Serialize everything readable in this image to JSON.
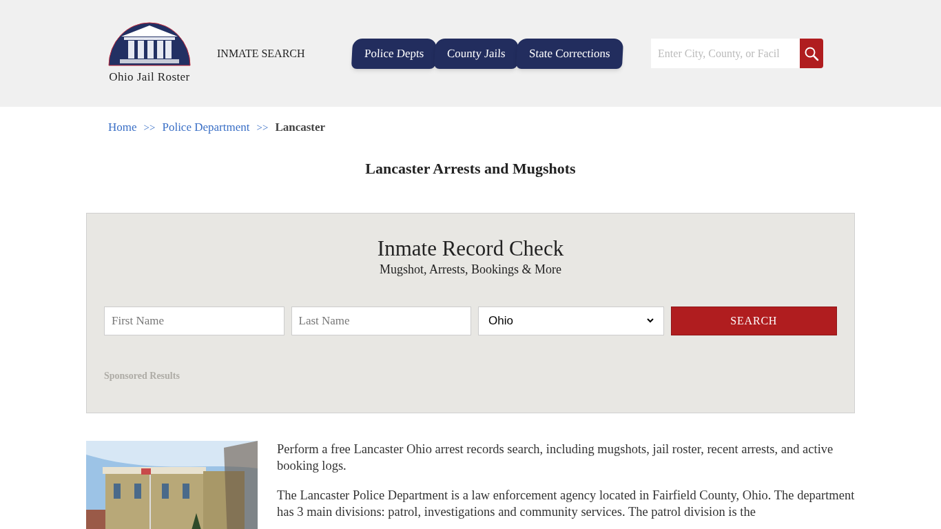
{
  "header": {
    "logo_text": "Ohio Jail Roster",
    "inmate_search_link": "INMATE SEARCH",
    "nav_tabs": [
      {
        "label": "Police Depts"
      },
      {
        "label": "County Jails"
      },
      {
        "label": "State Corrections"
      }
    ],
    "search": {
      "placeholder": "Enter City, County, or Facil"
    }
  },
  "breadcrumb": [
    {
      "label": "Home",
      "kind": "link"
    },
    {
      "label": ">>",
      "kind": "separator"
    },
    {
      "label": "Police Department",
      "kind": "link"
    },
    {
      "label": ">>",
      "kind": "separator"
    },
    {
      "label": "Lancaster",
      "kind": "current"
    }
  ],
  "page_title": "Lancaster Arrests and Mugshots",
  "record_check": {
    "title": "Inmate Record Check",
    "subtitle": "Mugshot, Arrests, Bookings & More",
    "first_name": {
      "placeholder": "First Name"
    },
    "last_name": {
      "placeholder": "Last Name"
    },
    "state": {
      "value": "Ohio"
    },
    "button": "SEARCH",
    "sponsored": "Sponsored Results"
  },
  "article": {
    "image": {
      "kind": "picture"
    },
    "paragraphs": [
      "Perform a free Lancaster Ohio arrest records search, including mugshots, jail roster, recent arrests, and active booking logs.",
      "The Lancaster Police Department is a law enforcement agency located in Fairfield County, Ohio. The department has 3 main divisions: patrol, investigations and community services. The patrol division is the"
    ]
  }
}
